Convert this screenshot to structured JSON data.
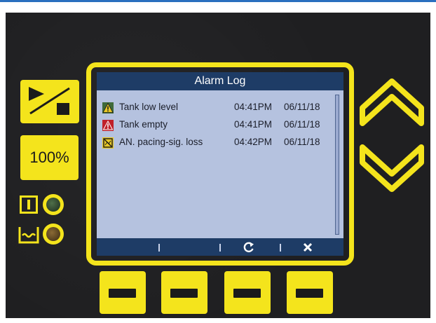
{
  "display": {
    "title": "Alarm Log",
    "alarms": [
      {
        "icon": "warning-icon",
        "text": "Tank low level",
        "time": "04:41PM",
        "date": "06/11/18"
      },
      {
        "icon": "alarm-icon",
        "text": "Tank empty",
        "time": "04:41PM",
        "date": "06/11/18"
      },
      {
        "icon": "signal-loss-icon",
        "text": "AN. pacing-sig. loss",
        "time": "04:42PM",
        "date": "06/11/18"
      }
    ],
    "softkeys": [
      "refresh-icon",
      "close-icon"
    ]
  },
  "controls": {
    "speed_label": "100%"
  },
  "colors": {
    "housing": "#1f1f21",
    "accent_yellow": "#f4e41c",
    "screen_bg": "#b5c2df",
    "screen_bar": "#1e3c66",
    "warning_icon": "#e8c928",
    "alarm_icon": "#c0202a"
  }
}
